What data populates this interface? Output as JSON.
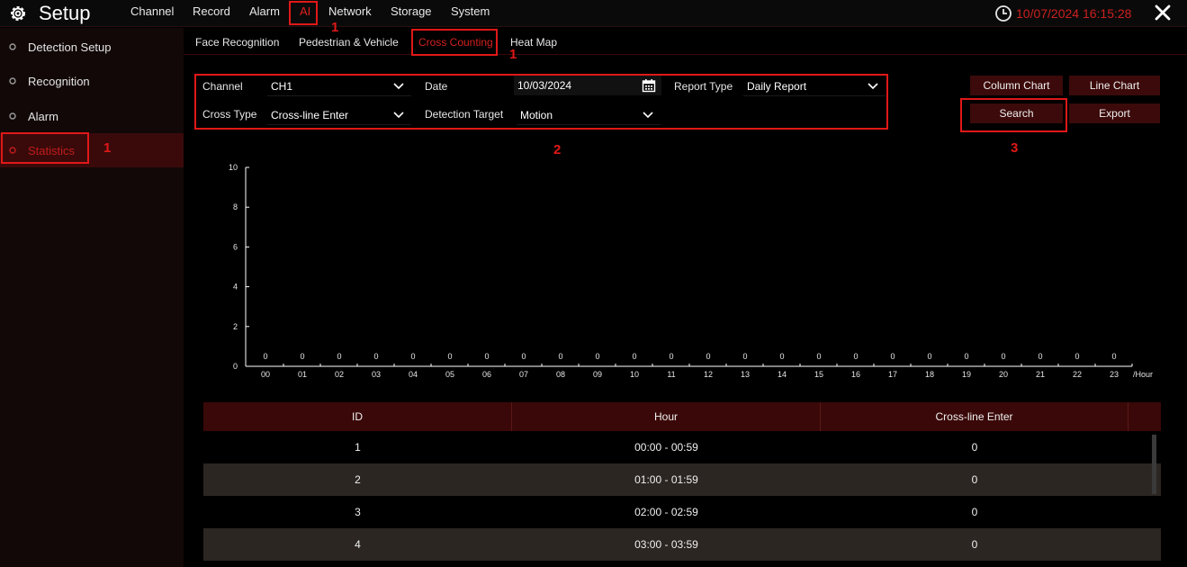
{
  "app": {
    "title": "Setup"
  },
  "menu": [
    "Channel",
    "Record",
    "Alarm",
    "AI",
    "Network",
    "Storage",
    "System"
  ],
  "clock": {
    "datetime": "10/07/2024 16:15:28"
  },
  "sidebar": {
    "items": [
      {
        "label": "Detection Setup"
      },
      {
        "label": "Recognition"
      },
      {
        "label": "Alarm"
      },
      {
        "label": "Statistics"
      }
    ]
  },
  "subtabs": [
    "Face Recognition",
    "Pedestrian & Vehicle",
    "Cross Counting",
    "Heat Map"
  ],
  "form": {
    "channel_label": "Channel",
    "channel_value": "CH1",
    "date_label": "Date",
    "date_value": "10/03/2024",
    "report_type_label": "Report Type",
    "report_type_value": "Daily Report",
    "cross_type_label": "Cross Type",
    "cross_type_value": "Cross-line Enter",
    "detection_target_label": "Detection Target",
    "detection_target_value": "Motion"
  },
  "buttons": {
    "column_chart": "Column Chart",
    "line_chart": "Line Chart",
    "search": "Search",
    "export": "Export"
  },
  "annotations": {
    "menu_ai": "1",
    "subtab_cross": "1",
    "sidebar_statistics": "1",
    "form": "2",
    "search": "3"
  },
  "chart_data": {
    "type": "bar",
    "categories": [
      "00",
      "01",
      "02",
      "03",
      "04",
      "05",
      "06",
      "07",
      "08",
      "09",
      "10",
      "11",
      "12",
      "13",
      "14",
      "15",
      "16",
      "17",
      "18",
      "19",
      "20",
      "21",
      "22",
      "23"
    ],
    "values": [
      0,
      0,
      0,
      0,
      0,
      0,
      0,
      0,
      0,
      0,
      0,
      0,
      0,
      0,
      0,
      0,
      0,
      0,
      0,
      0,
      0,
      0,
      0,
      0
    ],
    "y_ticks": [
      0,
      2,
      4,
      6,
      8,
      10
    ],
    "ylim": [
      0,
      10
    ],
    "x_unit": "/Hour",
    "grid": false
  },
  "table": {
    "headers": [
      "ID",
      "Hour",
      "Cross-line Enter"
    ],
    "rows": [
      [
        "1",
        "00:00 - 00:59",
        "0"
      ],
      [
        "2",
        "01:00 - 01:59",
        "0"
      ],
      [
        "3",
        "02:00 - 02:59",
        "0"
      ],
      [
        "4",
        "03:00 - 03:59",
        "0"
      ]
    ]
  },
  "colors": {
    "accent": "#e01818",
    "active_bg": "#3a0a0a",
    "button_bg": "#3c0a0a",
    "table_header_bg": "#3a0808",
    "row_alt_bg": "#2b2622"
  }
}
